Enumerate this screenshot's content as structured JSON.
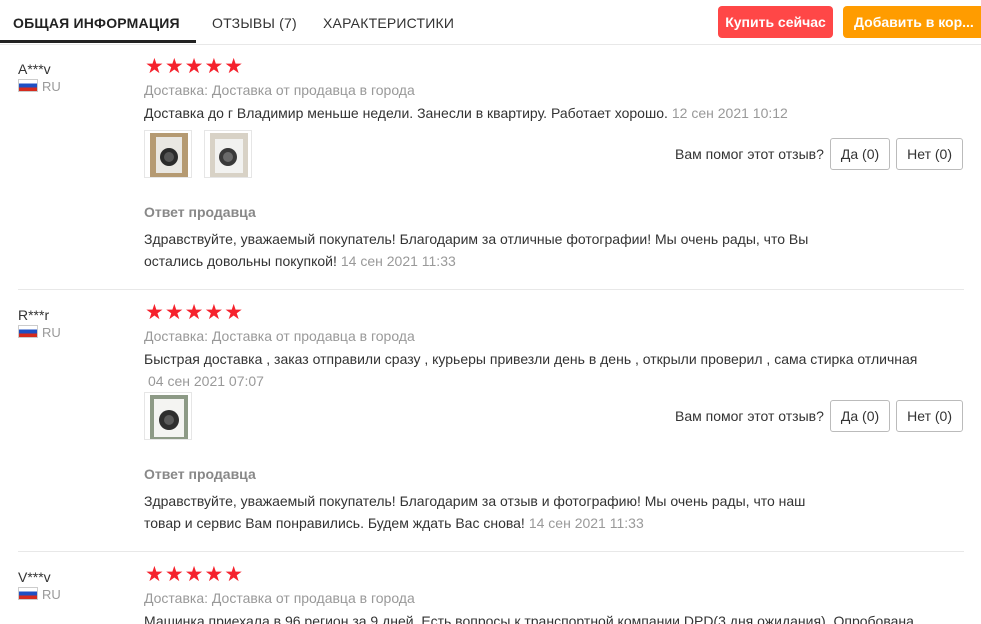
{
  "tabs": [
    {
      "label": "ОБЩАЯ ИНФОРМАЦИЯ"
    },
    {
      "label": "ОТЗЫВЫ (7)"
    },
    {
      "label": "ХАРАКТЕРИСТИКИ"
    }
  ],
  "buttons": {
    "buy_now": "Купить сейчас",
    "add_to_cart": "Добавить в кор..."
  },
  "colors": {
    "buy": "#ff4747",
    "cart": "#ff9c00",
    "stars": "#f5222d"
  },
  "reviews": [
    {
      "user": "A***v",
      "country": "RU",
      "rating": 5,
      "stars": "★★★★★",
      "delivery": "Доставка: Доставка от продавца в города",
      "text": "Доставка до г Владимир меньше недели. Занесли в квартиру. Работает хорошо.",
      "date": "12 сен 2021 10:12",
      "helpful_question": "Вам помог этот отзыв?",
      "yes": "Да (0)",
      "no": "Нет (0)",
      "seller_title": "Ответ продавца",
      "seller_text": "Здравствуйте, уважаемый покупатель! Благодарим за отличные фотографии! Мы очень рады, что Вы остались довольны покупкой!",
      "seller_date": "14 сен 2021 11:33"
    },
    {
      "user": "R***r",
      "country": "RU",
      "rating": 5,
      "stars": "★★★★★",
      "delivery": "Доставка: Доставка от продавца в города",
      "text": "Быстрая доставка , заказ отправили сразу , курьеры привезли день в день , открыли проверил , сама стирка отличная",
      "date": "04 сен 2021 07:07",
      "helpful_question": "Вам помог этот отзыв?",
      "yes": "Да (0)",
      "no": "Нет (0)",
      "seller_title": "Ответ продавца",
      "seller_text": "Здравствуйте, уважаемый покупатель! Благодарим за отзыв и фотографию! Мы очень рады, что наш товар и сервис Вам понравились. Будем ждать Вас снова!",
      "seller_date": "14 сен 2021 11:33"
    },
    {
      "user": "V***v",
      "country": "RU",
      "rating": 5,
      "stars": "★★★★★",
      "delivery": "Доставка: Доставка от продавца в города",
      "text": "Машинка приехала в 96 регион за 9 дней. Есть вопросы к транспортной компании DPD(3 дня ожидания). Опробована"
    }
  ]
}
